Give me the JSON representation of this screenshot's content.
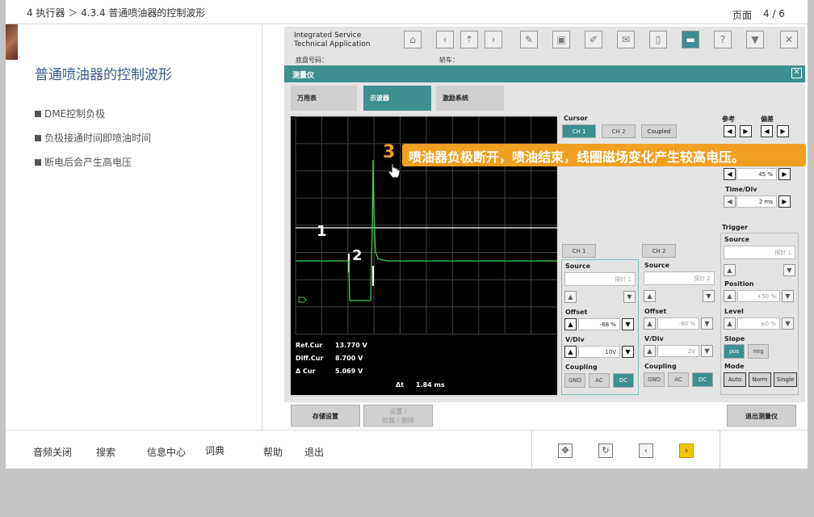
{
  "header": {
    "breadcrumb": "4 执行器 ＞ 4.3.4 普通喷油器的控制波形",
    "page_label": "页面",
    "page_value": "4 / 6"
  },
  "left": {
    "title": "普通喷油器的控制波形",
    "bullets": [
      "DME控制负极",
      "负极接通时间即喷油时间",
      "断电后会产生高电压"
    ]
  },
  "app": {
    "name_line1": "Integrated Service",
    "name_line2": "Technical Application",
    "field1": "底盘号码：",
    "field2": "轿车：",
    "module_title": "测量仪",
    "tabs": [
      "万用表",
      "示波器",
      "激励系统"
    ],
    "toolbar_icons": [
      "home-icon",
      "back-icon",
      "up-icon",
      "forward-icon",
      "wrench-icon",
      "diagnosis-icon",
      "tool-icon",
      "mail-icon",
      "battery-icon",
      "measure-icon",
      "help-icon",
      "print-icon",
      "close-icon"
    ]
  },
  "scope": {
    "labels": [
      "1",
      "2"
    ],
    "readouts": [
      {
        "label": "Ref.Cur",
        "value": "13.770 V"
      },
      {
        "label": "Diff.Cur",
        "value": "8.700 V"
      },
      {
        "label": "Δ Cur",
        "value": "5.069 V"
      }
    ],
    "dt_label": "Δt",
    "dt_value": "1.84 ms",
    "trace_color": "#3cd05c"
  },
  "controls": {
    "cursor": "Cursor",
    "ch1": "CH 1",
    "ch2": "CH 2",
    "coupled": "Coupled",
    "ref_label": "参考",
    "diff_label": "偏差",
    "pct": "45 %",
    "timediv_label": "Time/Div",
    "timediv": "2 ms",
    "trigger": "Trigger",
    "ch1_box": {
      "title": "CH 1",
      "source_label": "Source",
      "source": "探针 1",
      "offset_label": "Offset",
      "offset": "-68 %",
      "vdiv_label": "V/Div",
      "vdiv": "10V",
      "coupling_label": "Coupling",
      "coupling": [
        "GND",
        "AC",
        "DC"
      ]
    },
    "ch2_box": {
      "title": "CH 2",
      "source_label": "Source",
      "source": "探针 2",
      "offset_label": "Offset",
      "offset": "-60 %",
      "vdiv_label": "V/Div",
      "vdiv": "2V",
      "coupling_label": "Coupling",
      "coupling": [
        "GND",
        "AC",
        "DC"
      ]
    },
    "trigger_box": {
      "source_label": "Source",
      "source": "探针 1",
      "position_label": "Position",
      "position": "+50 %",
      "level_label": "Level",
      "level": "±0 %",
      "slope_label": "Slope",
      "slope": [
        "pos",
        "neg"
      ],
      "mode_label": "Mode",
      "mode": [
        "Auto",
        "Norm",
        "Single"
      ]
    }
  },
  "callout": {
    "number": "3",
    "text": "喷油器负极断开，喷油结束，线圈磁场变化产生较高电压。"
  },
  "footer_buttons": {
    "save": "存储设置",
    "load_line1": "设置 /",
    "load_line2": "加载 / 删除",
    "exit": "退出测量仪"
  },
  "nav": {
    "items": [
      "音频关闭",
      "搜索",
      "信息中心",
      "词典",
      "帮助",
      "退出"
    ],
    "icons": [
      "fullscreen-icon",
      "refresh-icon",
      "prev-icon",
      "next-icon"
    ]
  }
}
